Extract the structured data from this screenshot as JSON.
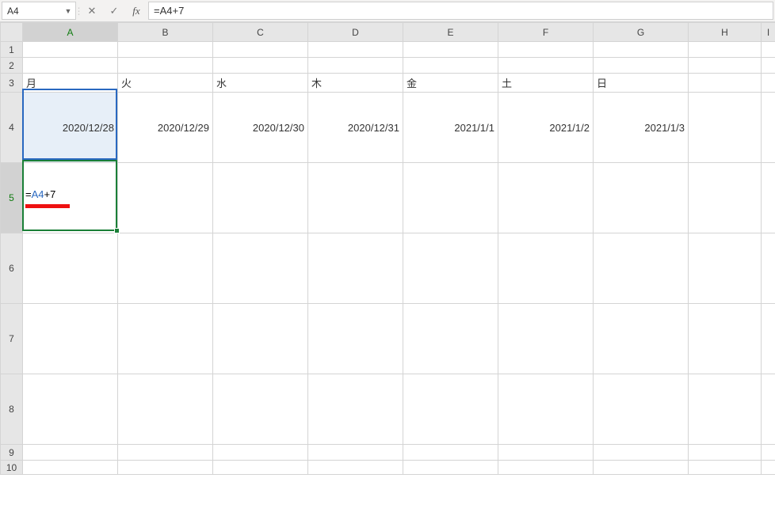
{
  "formula_bar": {
    "name_box": "A4",
    "cancel_tooltip": "Cancel",
    "enter_tooltip": "Enter",
    "fx_label": "fx",
    "formula": "=A4+7"
  },
  "columns": [
    "A",
    "B",
    "C",
    "D",
    "E",
    "F",
    "G",
    "H",
    "I"
  ],
  "active_column": "A",
  "rows": [
    "1",
    "2",
    "3",
    "4",
    "5",
    "6",
    "7",
    "8",
    "9",
    "10"
  ],
  "active_row": "5",
  "weekday_row": {
    "A": "月",
    "B": "火",
    "C": "水",
    "D": "木",
    "E": "金",
    "F": "土",
    "G": "日"
  },
  "date_row": {
    "A": "2020/12/28",
    "B": "2020/12/29",
    "C": "2020/12/30",
    "D": "2020/12/31",
    "E": "2021/1/1",
    "F": "2021/1/2",
    "G": "2021/1/3"
  },
  "editing_cell": {
    "address": "A5",
    "tokens": {
      "eq": "=",
      "ref": "A4",
      "rest": "+7"
    }
  },
  "referenced_cell": "A4",
  "chart_data": {
    "type": "table",
    "title": "",
    "columns": [
      "月",
      "火",
      "水",
      "木",
      "金",
      "土",
      "日"
    ],
    "rows": [
      [
        "2020/12/28",
        "2020/12/29",
        "2020/12/30",
        "2020/12/31",
        "2021/1/1",
        "2021/1/2",
        "2021/1/3"
      ]
    ]
  }
}
